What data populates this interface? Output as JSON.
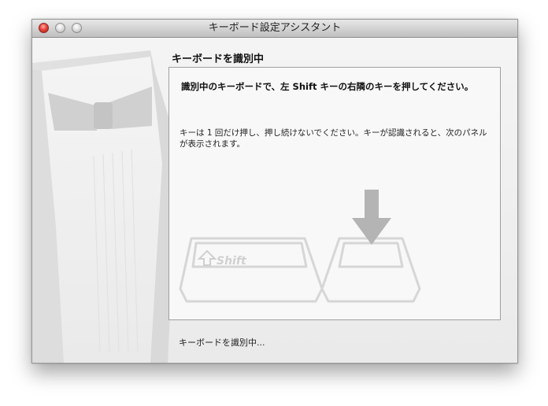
{
  "window": {
    "title": "キーボード設定アシスタント"
  },
  "section": {
    "title": "キーボードを識別中"
  },
  "panel": {
    "instruction": "識別中のキーボードで、左 Shift キーの右隣のキーを押してください。",
    "note": "キーは 1 回だけ押し、押し続けないでください。キーが認識されると、次のパネルが表示されます。",
    "key_label": "Shift"
  },
  "status": {
    "text": "キーボードを識別中..."
  },
  "icons": {
    "close": "close-button-icon",
    "minimize": "minimize-button-icon",
    "zoom": "zoom-button-icon",
    "arrow": "down-arrow-icon",
    "shift": "shift-arrow-icon"
  },
  "colors": {
    "close_red": "#e8433a",
    "panel_bg": "#f8f8f8",
    "arrow_gray": "#b4b4b4"
  }
}
